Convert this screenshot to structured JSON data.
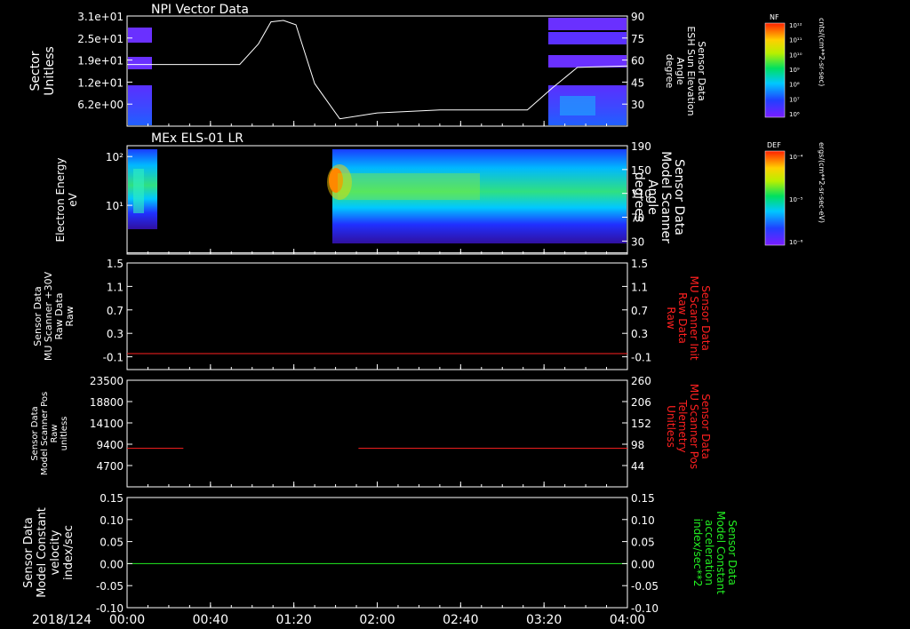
{
  "date_label": "2018/124",
  "x_ticks": [
    "00:00",
    "00:40",
    "01:20",
    "02:00",
    "02:40",
    "03:20",
    "04:00"
  ],
  "panels": {
    "npi": {
      "title": "NPI Vector Data",
      "left_label": [
        "Sector",
        "Unitless"
      ],
      "right_label": [
        "Sensor Data",
        "ESH Sun Elevation",
        "Angle",
        "degree"
      ],
      "left_ticks": [
        "3.1e+01",
        "2.5e+01",
        "1.9e+01",
        "1.2e+01",
        "6.2e+00"
      ],
      "right_ticks": [
        "90",
        "75",
        "60",
        "45",
        "30"
      ],
      "colorbar": {
        "label": "NF",
        "unit": "cnts/(cm**2-sr-sec)",
        "ticks": [
          "10¹²",
          "10¹¹",
          "10¹⁰",
          "10⁹",
          "10⁸",
          "10⁷",
          "10⁶"
        ]
      }
    },
    "els": {
      "title": "MEx ELS-01 LR",
      "left_label": [
        "Electron Energy",
        "eV"
      ],
      "right_label": [
        "Sensor Data",
        "Model Scanner",
        "Angle",
        "degrees"
      ],
      "left_ticks": [
        "10²",
        "10¹"
      ],
      "right_ticks": [
        "190",
        "150",
        "110",
        "70",
        "30"
      ],
      "colorbar": {
        "label": "DEF",
        "unit": "ergs/(cm**2-sr-sec-eV)",
        "ticks": [
          "10⁻⁴",
          "10⁻⁵",
          "10⁻⁶"
        ]
      }
    },
    "mu30": {
      "left_label": [
        "Sensor Data",
        "MU Scanner +30V",
        "Raw Data",
        "Raw"
      ],
      "right_label": [
        "Sensor Data",
        "MU Scanner Init",
        "Raw Data",
        "Raw"
      ],
      "left_ticks": [
        "1.5",
        "1.1",
        "0.7",
        "0.3",
        "-0.1"
      ],
      "right_ticks": [
        "1.5",
        "1.1",
        "0.7",
        "0.3",
        "-0.1"
      ]
    },
    "pos": {
      "left_label": [
        "Sensor Data",
        "Model Scanner Pos",
        "Raw",
        "unitless"
      ],
      "right_label": [
        "Sensor Data",
        "MU Scanner Pos",
        "Telemetry",
        "Unitless"
      ],
      "left_ticks": [
        "23500",
        "18800",
        "14100",
        "9400",
        "4700"
      ],
      "right_ticks": [
        "260",
        "206",
        "152",
        "98",
        "44"
      ]
    },
    "vel": {
      "left_label": [
        "Sensor Data",
        "Model Constant",
        "velocity",
        "index/sec"
      ],
      "right_label": [
        "Sensor Data",
        "Model Constant",
        "acceleration",
        "index/sec**2"
      ],
      "left_ticks": [
        "0.15",
        "0.10",
        "0.05",
        "0.00",
        "-0.05",
        "-0.10"
      ],
      "right_ticks": [
        "0.15",
        "0.10",
        "0.05",
        "0.00",
        "-0.05",
        "-0.10"
      ]
    }
  },
  "colors": {
    "red_line": "#ff2020",
    "green_line": "#22ee22",
    "white_line": "#ffffff",
    "axis": "#ffffff"
  },
  "chart_data": [
    {
      "type": "heatmap",
      "title": "NPI Vector Data",
      "x_range": [
        "00:00",
        "04:00"
      ],
      "ylabel": "Sector Unitless",
      "y_ticks": [
        31,
        25,
        19,
        12,
        6.2
      ],
      "data_coverage_hours": [
        [
          0.0,
          0.25
        ],
        [
          3.2,
          4.0
        ]
      ],
      "line_series": {
        "name": "ESH Sun Elevation Angle",
        "ylim": [
          15,
          90
        ],
        "x_hours": [
          0.0,
          0.5,
          0.9,
          1.05,
          1.15,
          1.25,
          1.35,
          1.5,
          1.7,
          2.0,
          2.5,
          3.0,
          3.2,
          3.4,
          3.6,
          4.0
        ],
        "y": [
          57,
          57,
          57,
          71,
          86,
          87,
          84,
          44,
          20,
          24,
          26,
          26,
          26,
          41,
          55,
          56
        ]
      }
    },
    {
      "type": "heatmap",
      "title": "MEx ELS-01 LR",
      "x_range": [
        "00:00",
        "04:00"
      ],
      "ylabel": "Electron Energy eV",
      "y_log_range": [
        1,
        200
      ],
      "data_coverage_hours": [
        [
          0.0,
          0.3
        ],
        [
          1.8,
          4.0
        ]
      ],
      "line_series": {
        "name": "Model Scanner Angle",
        "ylim": [
          10,
          190
        ],
        "x_hours": [
          0.0,
          4.0
        ],
        "y": [
          12,
          12
        ]
      }
    },
    {
      "type": "line",
      "ylim": [
        -0.3,
        1.5
      ],
      "series": [
        {
          "x_hours": [
            0.0,
            4.0
          ],
          "y": [
            -0.03,
            -0.03
          ]
        }
      ]
    },
    {
      "type": "line",
      "ylim": [
        0,
        23500
      ],
      "series": [
        {
          "x_hours": [
            0.0,
            0.45,
            1.85,
            4.0
          ],
          "y": [
            8500,
            8500,
            8500,
            8500
          ],
          "segments": [
            [
              0.0,
              0.45
            ],
            [
              1.85,
              4.0
            ]
          ]
        }
      ]
    },
    {
      "type": "line",
      "ylim": [
        -0.1,
        0.15
      ],
      "series": [
        {
          "x_hours": [
            0.0,
            4.0
          ],
          "y": [
            0.0,
            0.0
          ]
        }
      ]
    }
  ]
}
